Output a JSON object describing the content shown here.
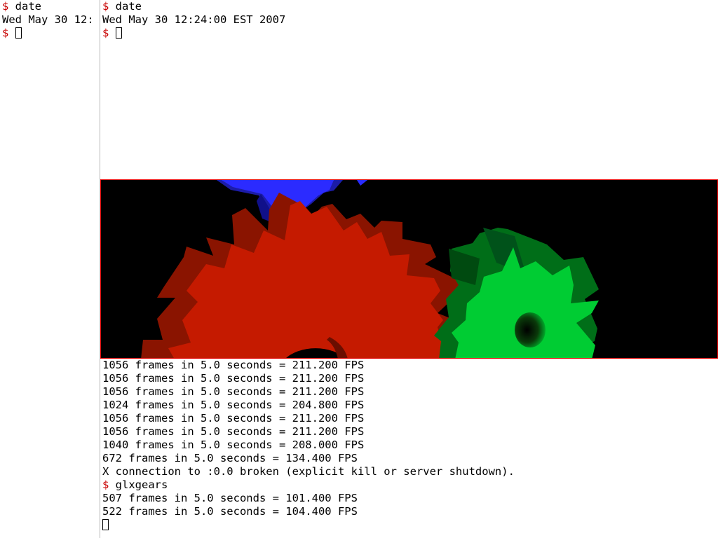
{
  "left_terminal": {
    "lines": [
      {
        "prompt": "$",
        "text": " date"
      },
      {
        "prompt": "",
        "text": "Wed May 30 12:"
      },
      {
        "prompt": "$",
        "text": " "
      }
    ]
  },
  "top_terminal": {
    "lines": [
      {
        "prompt": "$",
        "text": " date"
      },
      {
        "prompt": "",
        "text": "Wed May 30 12:24:00 EST 2007"
      },
      {
        "prompt": "$",
        "text": " "
      }
    ]
  },
  "gears_window": {
    "title": "glxgears",
    "colors": {
      "red": "#c51a00",
      "green": "#00cc33",
      "blue": "#2b2bff",
      "background": "#000000",
      "border": "#e00000"
    }
  },
  "bottom_terminal": {
    "lines": [
      {
        "prompt": "",
        "text": "1056 frames in 5.0 seconds = 211.200 FPS"
      },
      {
        "prompt": "",
        "text": "1056 frames in 5.0 seconds = 211.200 FPS"
      },
      {
        "prompt": "",
        "text": "1056 frames in 5.0 seconds = 211.200 FPS"
      },
      {
        "prompt": "",
        "text": "1024 frames in 5.0 seconds = 204.800 FPS"
      },
      {
        "prompt": "",
        "text": "1056 frames in 5.0 seconds = 211.200 FPS"
      },
      {
        "prompt": "",
        "text": "1056 frames in 5.0 seconds = 211.200 FPS"
      },
      {
        "prompt": "",
        "text": "1040 frames in 5.0 seconds = 208.000 FPS"
      },
      {
        "prompt": "",
        "text": "672 frames in 5.0 seconds = 134.400 FPS"
      },
      {
        "prompt": "",
        "text": "X connection to :0.0 broken (explicit kill or server shutdown)."
      },
      {
        "prompt": "$",
        "text": " glxgears"
      },
      {
        "prompt": "",
        "text": "507 frames in 5.0 seconds = 101.400 FPS"
      },
      {
        "prompt": "",
        "text": "522 frames in 5.0 seconds = 104.400 FPS"
      },
      {
        "prompt": "",
        "text": ""
      }
    ]
  }
}
